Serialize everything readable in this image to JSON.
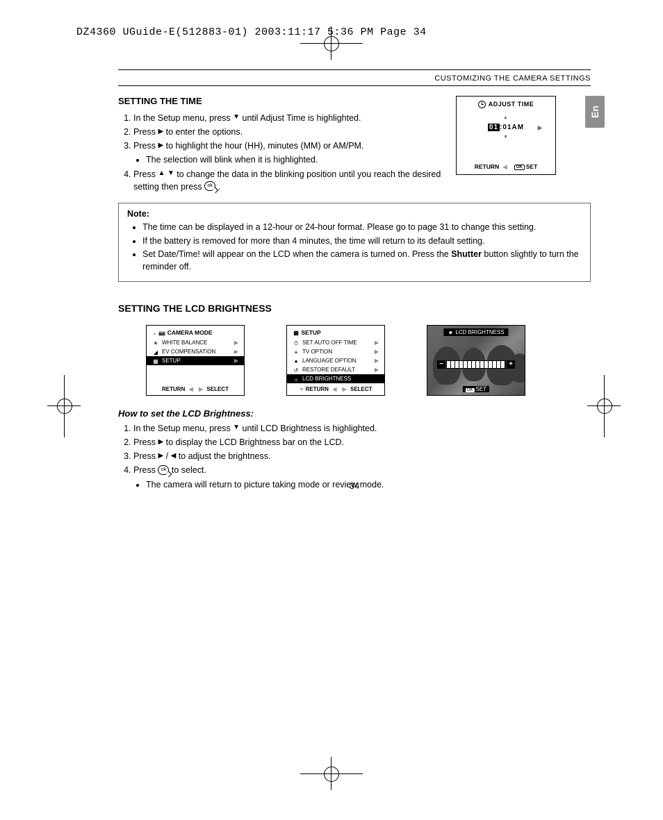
{
  "runhead": "DZ4360 UGuide-E(512883-01)  2003:11:17  5:36 PM  Page 34",
  "header": "CUSTOMIZING THE CAMERA SETTINGS",
  "lang_tab": "En",
  "section_time_title": "SETTING THE TIME",
  "steps_time": {
    "s1a": "In the Setup menu, press ",
    "s1b": " until Adjust Time is highlighted.",
    "s2a": "Press ",
    "s2b": " to enter the options.",
    "s3a": "Press ",
    "s3b": " to highlight the hour (HH), minutes (MM) or AM/PM.",
    "s3sub": "The selection will blink when it is highlighted.",
    "s4a": "Press ",
    "s4b": " to change the data in the blinking position until you reach the desired setting then press ",
    "s4c": " ."
  },
  "lcd_adjust": {
    "title": "ADJUST  TIME",
    "hh": "01",
    "rest": ":01AM",
    "return": "RETURN",
    "set": "SET"
  },
  "note": {
    "title": "Note:",
    "n1": "The time can be displayed in a 12-hour or 24-hour format. Please go to page 31 to change this setting.",
    "n2": "If the battery is removed for more than 4 minutes, the time will return to its default setting.",
    "n3a": "Set Date/Time! will appear on the LCD when the camera is turned on. Press the ",
    "n3bold": "Shutter",
    "n3b": " button slightly to turn the reminder off."
  },
  "section_lcd_title": "SETTING THE LCD BRIGHTNESS",
  "panel1": {
    "top": "CAMERA MODE",
    "i1": "WHITE BALANCE",
    "i2": "EV COMPENSATION",
    "i3": "SETUP",
    "return": "RETURN",
    "select": "SELECT"
  },
  "panel2": {
    "top": "SETUP",
    "i1": "SET AUTO OFF TIME",
    "i2": "TV OPTION",
    "i3": "LANGUAGE OPTION",
    "i4": "RESTORE DEFAULT",
    "i5": "LCD BRIGHTNESS",
    "return": "RETURN",
    "select": "SELECT"
  },
  "panel3": {
    "title": "LCD BRIGHTNESS",
    "set": "SET"
  },
  "howto_title": "How to set the LCD Brightness:",
  "steps_lcd": {
    "s1a": "In the Setup menu, press ",
    "s1b": " until LCD Brightness is highlighted.",
    "s2a": "Press ",
    "s2b": " to display the LCD Brightness bar on the LCD.",
    "s3a": "Press ",
    "s3b": " / ",
    "s3c": " to adjust the brightness.",
    "s4a": "Press ",
    "s4b": " to select.",
    "s4sub": "The camera will return to picture taking mode or review mode."
  },
  "page_number": "34"
}
